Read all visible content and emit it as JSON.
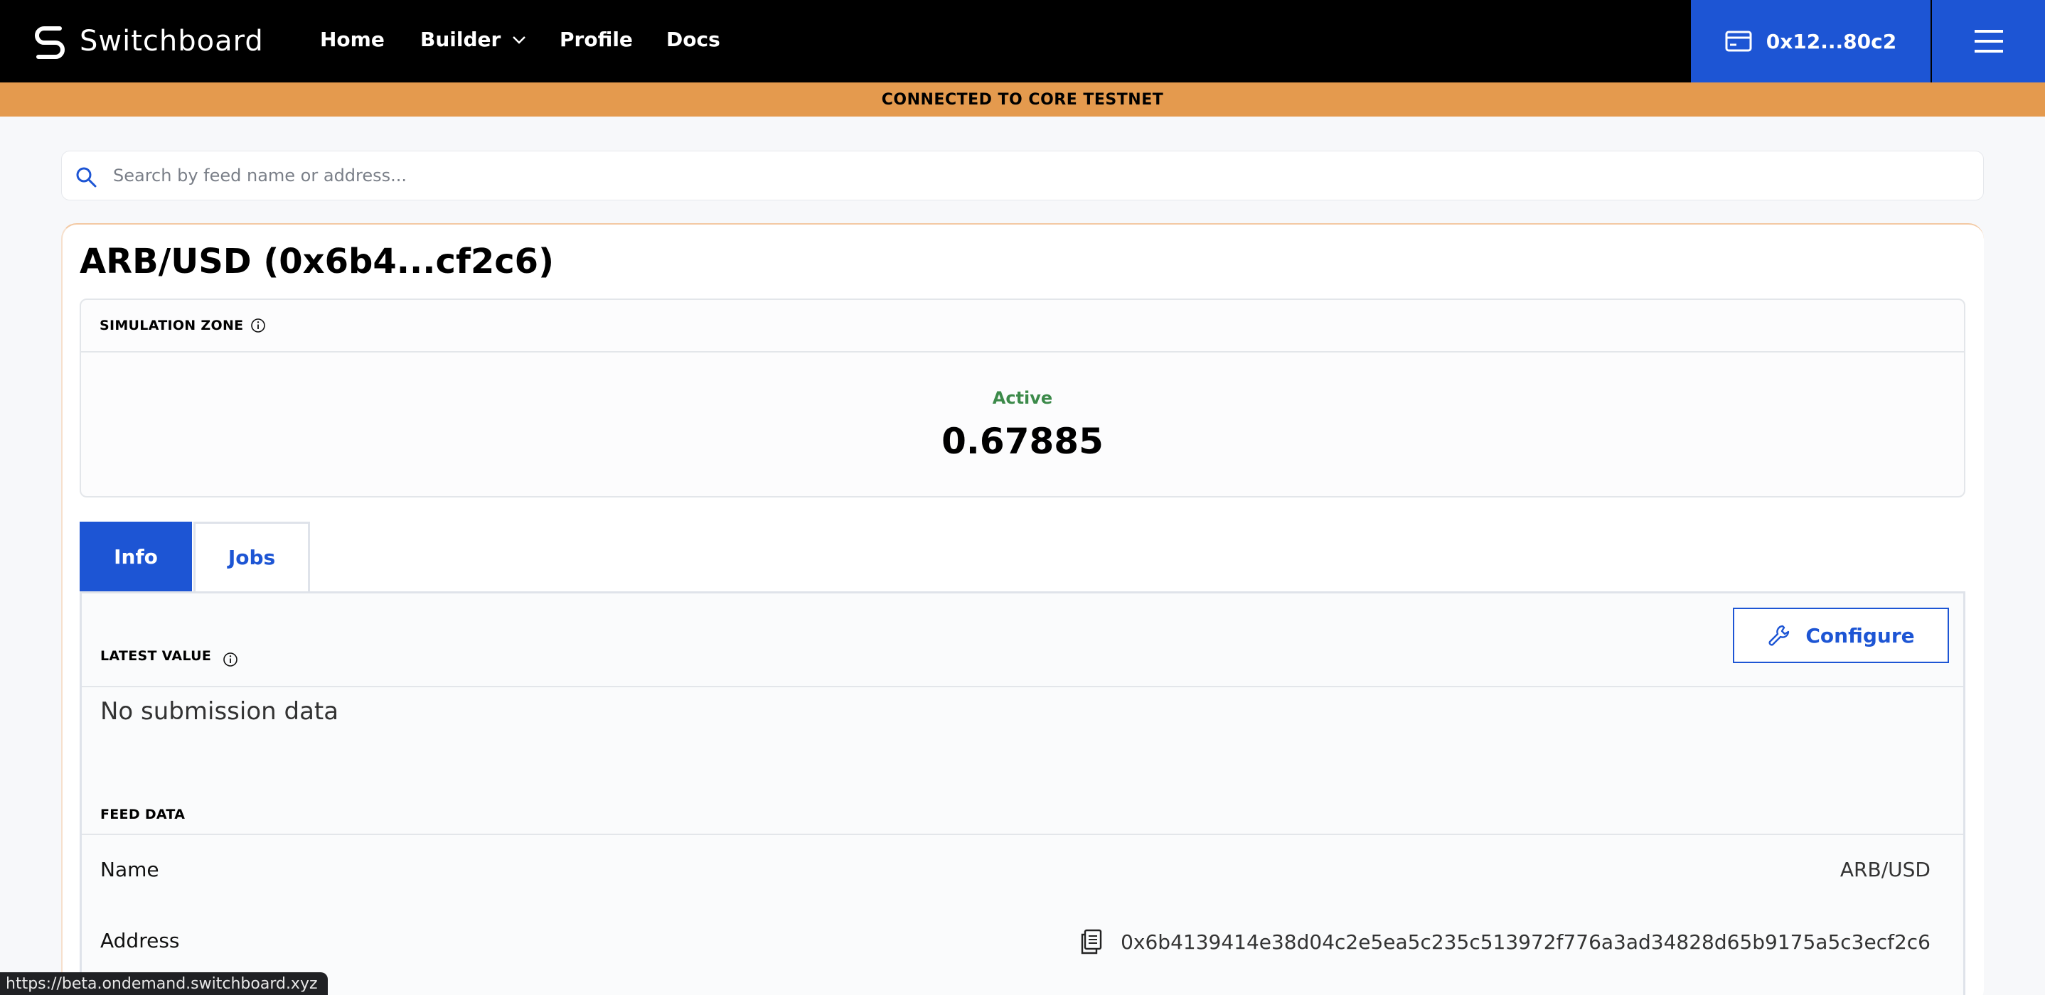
{
  "nav": {
    "brand": "Switchboard",
    "links": [
      "Home",
      "Builder",
      "Profile",
      "Docs"
    ],
    "wallet_label": "0x12...80c2"
  },
  "banner": {
    "text": "CONNECTED TO CORE TESTNET"
  },
  "search": {
    "placeholder": "Search by feed name or address..."
  },
  "feed": {
    "title": "ARB/USD (0x6b4...cf2c6)",
    "simulation": {
      "label": "SIMULATION ZONE",
      "status": "Active",
      "value": "0.67885"
    },
    "tabs": [
      "Info",
      "Jobs"
    ],
    "info": {
      "latest_value_label": "LATEST VALUE",
      "configure_label": "Configure",
      "no_data": "No submission data",
      "feed_data_label": "FEED DATA",
      "rows": [
        {
          "label": "Name",
          "value": "ARB/USD"
        },
        {
          "label": "Address",
          "value": "0x6b4139414e38d04c2e5ea5c235c513972f776a3ad34828d65b9175a5c3ecf2c6"
        }
      ]
    }
  },
  "status_bar": {
    "url": "https://beta.ondemand.switchboard.xyz"
  },
  "colors": {
    "accent": "#1d55d4",
    "banner": "#e49a4e",
    "active": "#3c8a4a"
  },
  "icons": [
    "switchboard-logo-icon",
    "chevron-down-icon",
    "wallet-icon",
    "hamburger-menu-icon",
    "search-icon",
    "info-icon",
    "wrench-icon",
    "copy-icon"
  ]
}
